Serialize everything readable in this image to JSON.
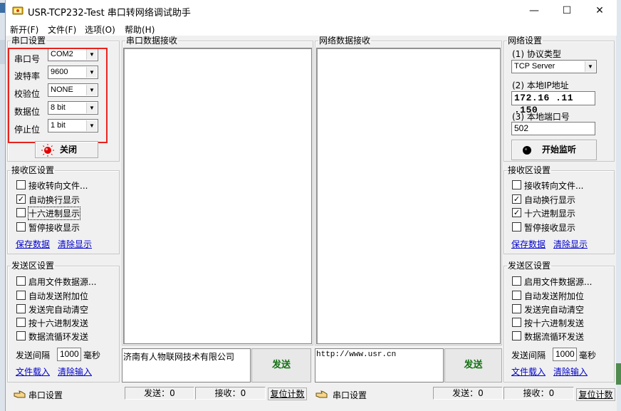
{
  "window": {
    "title": "USR-TCP232-Test 串口转网络调试助手",
    "minimize": "—",
    "maximize": "☐",
    "close": "✕"
  },
  "menu": [
    "新开(F)",
    "文件(F)",
    "选项(O)",
    "帮助(H)"
  ],
  "serial_settings": {
    "title": "串口设置",
    "port_label": "串口号",
    "port_value": "COM2",
    "baud_label": "波特率",
    "baud_value": "9600",
    "parity_label": "校验位",
    "parity_value": "NONE",
    "data_label": "数据位",
    "data_value": "8 bit",
    "stop_label": "停止位",
    "stop_value": "1 bit",
    "toggle_button": "关闭"
  },
  "left_receive": {
    "title": "接收区设置",
    "options": [
      {
        "label": "接收转向文件...",
        "checked": false
      },
      {
        "label": "自动换行显示",
        "checked": true
      },
      {
        "label": "十六进制显示",
        "checked": false
      },
      {
        "label": "暂停接收显示",
        "checked": false
      }
    ],
    "save_link": "保存数据",
    "clear_link": "清除显示"
  },
  "left_send": {
    "title": "发送区设置",
    "options": [
      {
        "label": "启用文件数据源...",
        "checked": false
      },
      {
        "label": "自动发送附加位",
        "checked": false
      },
      {
        "label": "发送完自动清空",
        "checked": false
      },
      {
        "label": "按十六进制发送",
        "checked": false
      },
      {
        "label": "数据流循环发送",
        "checked": false
      }
    ],
    "interval_label": "发送间隔",
    "interval_value": "1000",
    "interval_unit": "毫秒",
    "load_link": "文件载入",
    "clear_link": "清除输入"
  },
  "serial_receive_title": "串口数据接收",
  "net_receive_title": "网络数据接收",
  "serial_send_text": "济南有人物联网技术有限公司",
  "net_send_text": "http://www.usr.cn",
  "send_button": "发送",
  "net_settings": {
    "title": "网络设置",
    "protocol_label": "(1) 协议类型",
    "protocol_value": "TCP Server",
    "ip_label": "(2) 本地IP地址",
    "ip_value": "172.16 .11 .150",
    "port_label": "(3) 本地端口号",
    "port_value": "502",
    "start_button": "开始监听"
  },
  "right_receive": {
    "title": "接收区设置",
    "options": [
      {
        "label": "接收转向文件...",
        "checked": false
      },
      {
        "label": "自动换行显示",
        "checked": true
      },
      {
        "label": "十六进制显示",
        "checked": true
      },
      {
        "label": "暂停接收显示",
        "checked": false
      }
    ],
    "save_link": "保存数据",
    "clear_link": "清除显示"
  },
  "right_send": {
    "title": "发送区设置",
    "options": [
      {
        "label": "启用文件数据源...",
        "checked": false
      },
      {
        "label": "自动发送附加位",
        "checked": false
      },
      {
        "label": "发送完自动清空",
        "checked": false
      },
      {
        "label": "按十六进制发送",
        "checked": false
      },
      {
        "label": "数据流循环发送",
        "checked": false
      }
    ],
    "interval_label": "发送间隔",
    "interval_value": "1000",
    "interval_unit": "毫秒",
    "load_link": "文件载入",
    "clear_link": "清除输入"
  },
  "status": {
    "left_label": "串口设置",
    "left_send": "发送：0",
    "left_recv": "接收：0",
    "left_reset": "复位计数",
    "right_label": "串口设置",
    "right_send": "发送：0",
    "right_recv": "接收：0",
    "right_reset": "复位计数"
  },
  "colors": {
    "highlight_box": "#e8231f",
    "link": "#0000cc",
    "send_button_text": "#107010"
  }
}
